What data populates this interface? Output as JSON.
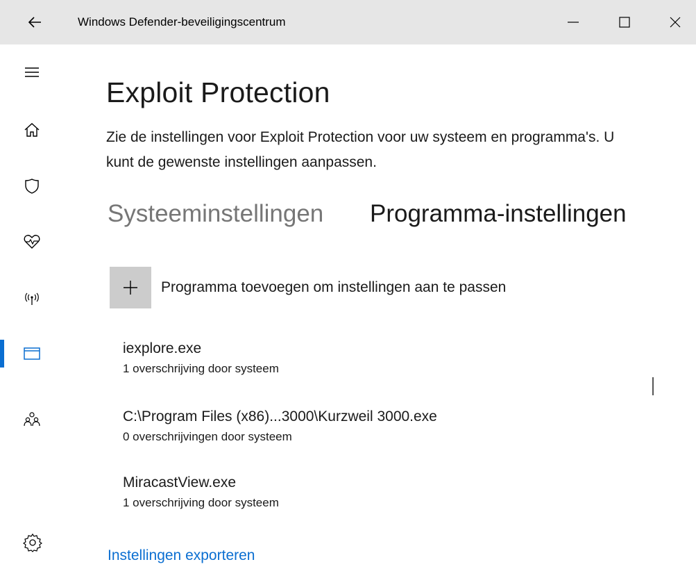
{
  "window": {
    "title": "Windows Defender-beveiligingscentrum"
  },
  "sidebar": {
    "items": [
      {
        "icon": "hamburger-menu-icon"
      },
      {
        "icon": "home-icon"
      },
      {
        "icon": "shield-icon"
      },
      {
        "icon": "heart-pulse-icon"
      },
      {
        "icon": "wireless-antenna-icon"
      },
      {
        "icon": "app-browser-icon",
        "active": true
      },
      {
        "icon": "family-icon"
      },
      {
        "icon": "gear-icon"
      }
    ]
  },
  "main": {
    "title": "Exploit Protection",
    "description": "Zie de instellingen voor Exploit Protection voor uw systeem en programma's. U kunt de gewenste instellingen aanpassen.",
    "tabs": [
      {
        "label": "Systeeminstellingen",
        "selected": false
      },
      {
        "label": "Programma-instellingen",
        "selected": true
      }
    ],
    "add_program_label": "Programma toevoegen om instellingen aan te passen",
    "programs": [
      {
        "name": "iexplore.exe",
        "overrides": "1 overschrijving door systeem"
      },
      {
        "name": "C:\\Program Files (x86)...3000\\Kurzweil 3000.exe",
        "overrides": "0 overschrijvingen door systeem"
      },
      {
        "name": "MiracastView.exe",
        "overrides": "1 overschrijving door systeem"
      }
    ],
    "export_link": "Instellingen exporteren"
  },
  "colors": {
    "accent": "#0a6ed1",
    "titlebar": "#e6e6e6",
    "add_button_bg": "#cccccc",
    "inactive_tab": "#767676"
  }
}
